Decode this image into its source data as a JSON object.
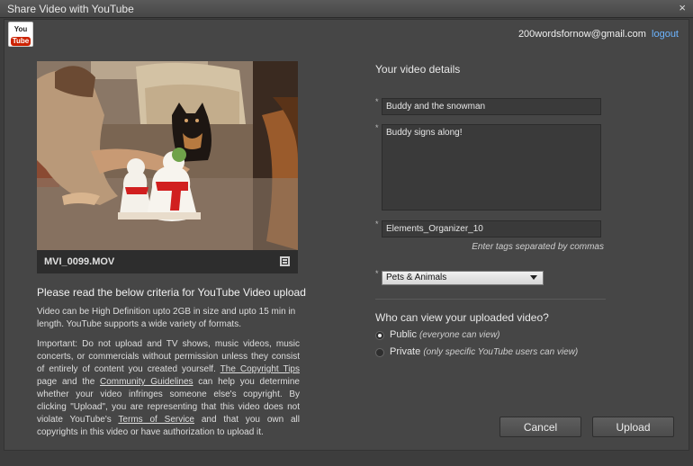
{
  "window": {
    "title": "Share Video with YouTube",
    "close_symbol": "×"
  },
  "logo": {
    "you": "You",
    "tube": "Tube"
  },
  "account": {
    "email": "200wordsfornow@gmail.com",
    "logout": "logout"
  },
  "video": {
    "filename": "MVI_0099.MOV"
  },
  "criteria": {
    "title": "Please read the below criteria for YouTube Video upload",
    "size_text": "Video can be High Definition upto 2GB in size and upto 15 min in length. YouTube supports a wide variety of formats.",
    "important_1": "Important: Do not upload and TV shows, music videos, music concerts, or commercials without permission unless they consist of entirely of content you created yourself.",
    "copyright_link": "The Copyright Tips",
    "important_2": "page and the",
    "guidelines_link": "Community Guidelines",
    "important_3": "can help you determine whether your video infringes someone else's copyright. By clicking \"Upload\", you are representing that this video does not violate YouTube's",
    "terms_link": "Terms of Service",
    "important_4": "and that you own all copyrights in this video or have authorization to upload it."
  },
  "details": {
    "title": "Your video details",
    "required_marker": "*",
    "title_value": "Buddy and the snowman",
    "description_value": "Buddy signs along!",
    "tags_value": "Elements_Organizer_10",
    "tags_hint": "Enter tags separated by commas",
    "category_selected": "Pets & Animals"
  },
  "privacy": {
    "title": "Who can view your uploaded video?",
    "selected": "public",
    "public_label": "Public",
    "public_hint": "(everyone can view)",
    "private_label": "Private",
    "private_hint": "(only specific YouTube users can view)"
  },
  "buttons": {
    "cancel": "Cancel",
    "upload": "Upload"
  },
  "colors": {
    "background": "#464646",
    "link": "#6cb4ff",
    "logo_red": "#cc2200"
  },
  "icons": {
    "close": "close-icon",
    "film": "film-strip-icon",
    "dropdown": "chevron-down-icon"
  }
}
